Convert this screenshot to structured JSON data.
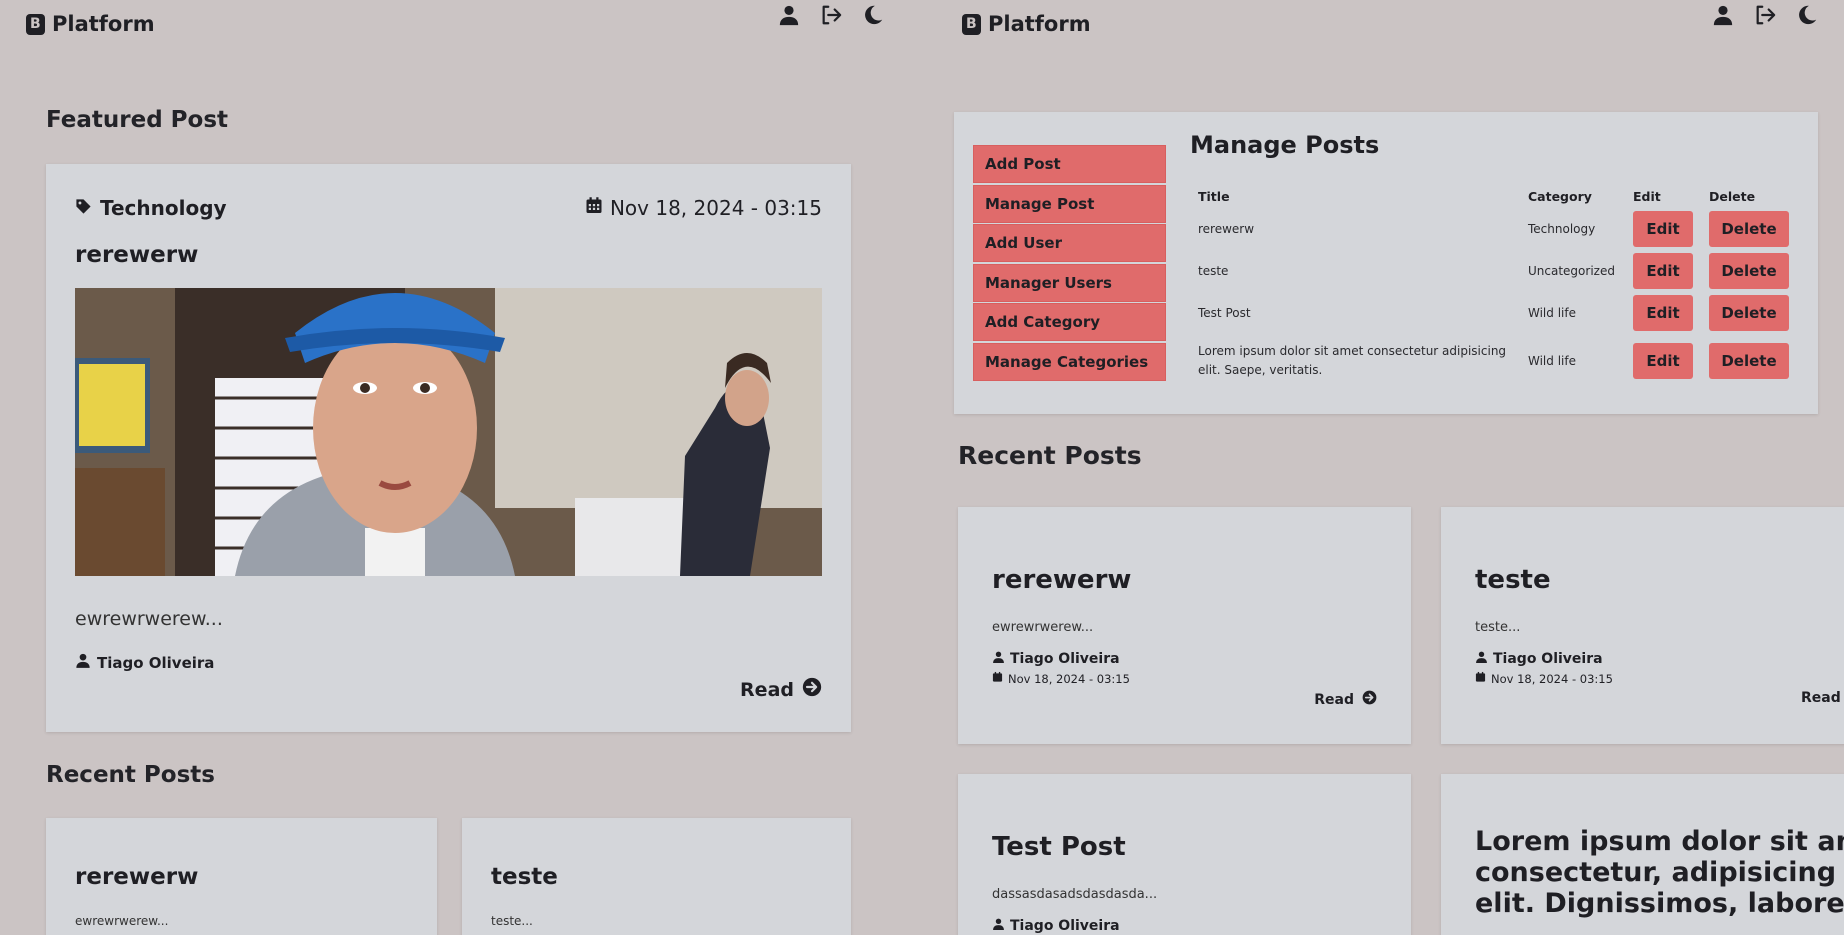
{
  "brand": "Platform",
  "left": {
    "featured_heading": "Featured Post",
    "featured": {
      "category": "Technology",
      "date": "Nov 18, 2024 - 03:15",
      "title": "rerewerw",
      "excerpt": "ewrewrwerew...",
      "author": "Tiago Oliveira",
      "read_label": "Read"
    },
    "recent_heading": "Recent Posts",
    "recent": [
      {
        "title": "rerewerw",
        "excerpt": "ewrewrwerew..."
      },
      {
        "title": "teste",
        "excerpt": "teste..."
      }
    ]
  },
  "right": {
    "menu": [
      "Add Post",
      "Manage Post",
      "Add User",
      "Manager Users",
      "Add Category",
      "Manage Categories"
    ],
    "manage_title": "Manage Posts",
    "columns": [
      "Title",
      "Category",
      "Edit",
      "Delete"
    ],
    "rows": [
      {
        "title": "rerewerw",
        "category": "Technology"
      },
      {
        "title": "teste",
        "category": "Uncategorized"
      },
      {
        "title": "Test Post",
        "category": "Wild life"
      },
      {
        "title": "Lorem ipsum dolor sit amet consectetur adipisicing elit. Saepe, veritatis.",
        "category": "Wild life"
      }
    ],
    "edit_label": "Edit",
    "delete_label": "Delete",
    "recent_heading": "Recent Posts",
    "recent": [
      {
        "title": "rerewerw",
        "excerpt": "ewrewrwerew...",
        "author": "Tiago Oliveira",
        "date": "Nov 18, 2024 - 03:15",
        "read_label": "Read"
      },
      {
        "title": "teste",
        "excerpt": "teste...",
        "author": "Tiago Oliveira",
        "date": "Nov 18, 2024 - 03:15",
        "read_label": "Read"
      },
      {
        "title": "Test Post",
        "excerpt": "dassasdasadsdasdasda...",
        "author": "Tiago Oliveira"
      },
      {
        "title": "Lorem ipsum dolor sit amet consectetur, adipisicing elit. Dignissimos, labore!"
      }
    ]
  },
  "colors": {
    "background": "#cbc4c4",
    "card": "#d4d6da",
    "accent": "#e06b6b",
    "text": "#1f1f24"
  },
  "icons": [
    "blog-icon",
    "user-icon",
    "logout-icon",
    "moon-icon",
    "tag-icon",
    "calendar-icon",
    "arrow-circle-right-icon"
  ]
}
